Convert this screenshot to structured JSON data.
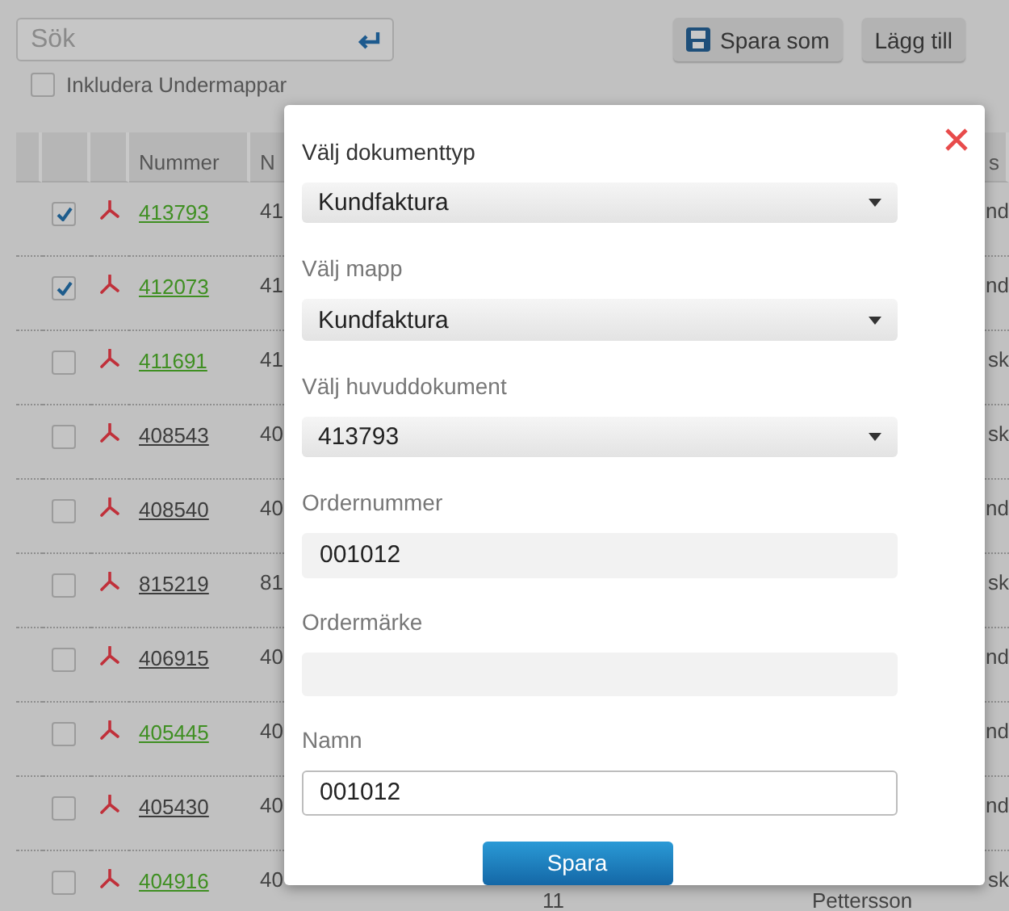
{
  "search": {
    "placeholder": "Sök"
  },
  "toolbar": {
    "buttons": [
      {
        "label": "Spara som",
        "kind": "save"
      },
      {
        "label": "Lägg till",
        "kind": "plain"
      }
    ]
  },
  "include_subfolders": {
    "label": "Inkludera Undermappar",
    "checked": false
  },
  "table": {
    "columns": [
      "",
      "",
      "",
      "Nummer",
      "N",
      "",
      "",
      "",
      "s"
    ],
    "rows": [
      {
        "checked": true,
        "number": "413793",
        "color": "#3f8f22",
        "column_5": "41",
        "column_9": "nd"
      },
      {
        "checked": true,
        "number": "412073",
        "color": "#3f8f22",
        "column_5": "41",
        "column_9": "nd"
      },
      {
        "checked": false,
        "number": "411691",
        "color": "#3f8f22",
        "column_5": "41",
        "column_9": "sk"
      },
      {
        "checked": false,
        "number": "408543",
        "color": "#3c3c3c",
        "column_5": "40",
        "column_9": "sk"
      },
      {
        "checked": false,
        "number": "408540",
        "color": "#3c3c3c",
        "column_5": "40",
        "column_9": "nd"
      },
      {
        "checked": false,
        "number": "815219",
        "color": "#3c3c3c",
        "column_5": "81",
        "column_9": "sk"
      },
      {
        "checked": false,
        "number": "406915",
        "color": "#3c3c3c",
        "column_5": "40",
        "column_9": "nd"
      },
      {
        "checked": false,
        "number": "405445",
        "color": "#3f8f22",
        "column_5": "40",
        "column_9": "nd"
      },
      {
        "checked": false,
        "number": "405430",
        "color": "#3c3c3c",
        "column_5": "40",
        "column_9": "nd"
      },
      {
        "checked": false,
        "number": "404916",
        "color": "#3f8f22",
        "column_5": "40",
        "column_6": "11",
        "column_8": "Pettersson",
        "column_9": "sk"
      }
    ]
  },
  "dialog": {
    "fields": [
      {
        "label": "Välj dokumenttyp",
        "kind": "select",
        "value": "Kundfaktura"
      },
      {
        "label": "Välj mapp",
        "kind": "select",
        "value": "Kundfaktura"
      },
      {
        "label": "Välj huvuddokument",
        "kind": "select",
        "value": "413793"
      },
      {
        "label": "Ordernummer",
        "kind": "text",
        "value": "001012",
        "disabled": true
      },
      {
        "label": "Ordermärke",
        "kind": "text",
        "disabled": true
      },
      {
        "label": "Namn",
        "kind": "text",
        "value": "001012",
        "disabled": false
      }
    ],
    "submit": "Spara"
  }
}
